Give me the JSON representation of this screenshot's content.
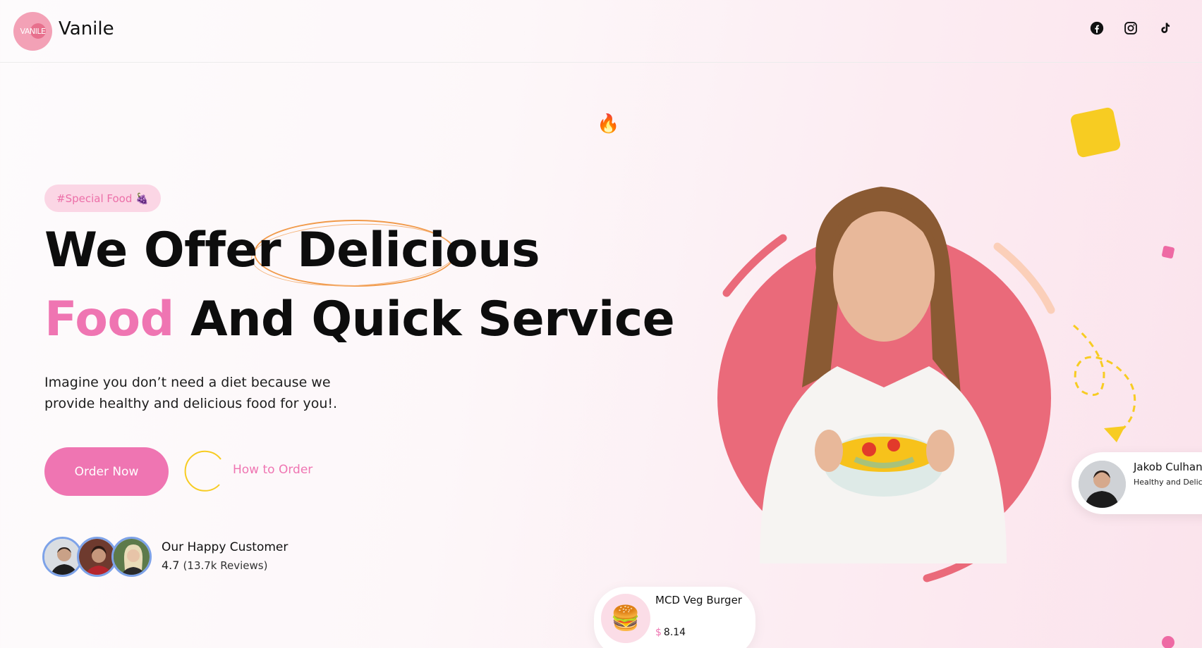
{
  "header": {
    "logo_text": "VANILE",
    "brand": "Vanile",
    "social": [
      {
        "icon": "facebook-icon"
      },
      {
        "icon": "instagram-icon"
      },
      {
        "icon": "tiktok-icon"
      }
    ]
  },
  "hero": {
    "tag": "#Special Food 🍇",
    "headline_part1": "We Offer Delicious",
    "headline_pink": "Food",
    "headline_part2": " And Quick Service",
    "description": "Imagine you don’t need a diet because we provide healthy and delicious food for you!.",
    "order_button": "Order Now",
    "how_to_order": "How to Order",
    "customers": {
      "title": "Our Happy Customer",
      "rating": "4.7",
      "reviews": "(13.7k Reviews)"
    }
  },
  "product_card": {
    "name": "MCD Veg Burger",
    "currency": "$",
    "price": "8.14",
    "icon": "🍔"
  },
  "review_card": {
    "name": "Jakob Culhane",
    "subtitle": "Healthy and Delicious"
  },
  "colors": {
    "accent_pink": "#ef75b2",
    "circle_red": "#ea6a7a",
    "yellow": "#f7cc22"
  }
}
